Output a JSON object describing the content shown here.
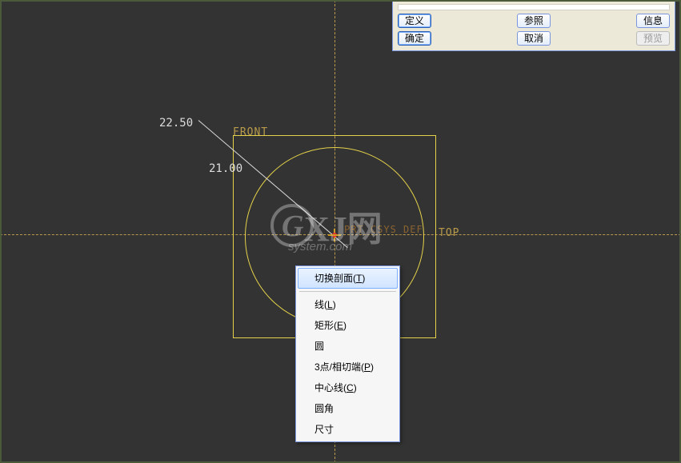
{
  "dialog": {
    "row1": {
      "define": "定义",
      "reference": "参照",
      "info": "信息"
    },
    "row2": {
      "ok": "确定",
      "cancel": "取消",
      "preview": "预览"
    }
  },
  "dimensions": {
    "d1": "22.50",
    "d2": "21.00"
  },
  "labels": {
    "front": "FRONT",
    "top": "TOP",
    "csys": "PRT_CSYS_DEF"
  },
  "watermark": {
    "main": "XJ网",
    "sub": "system.com"
  },
  "context_menu": {
    "items": [
      {
        "label": "切换剖面",
        "accel": "T",
        "hover": true
      },
      {
        "sep": true
      },
      {
        "label": "线",
        "accel": "L"
      },
      {
        "label": "矩形",
        "accel": "E"
      },
      {
        "label": "圆",
        "accel": ""
      },
      {
        "label": "3点/相切端",
        "accel": "P"
      },
      {
        "label": "中心线",
        "accel": "C"
      },
      {
        "label": "圆角",
        "accel": ""
      },
      {
        "label": "尺寸",
        "accel": ""
      }
    ]
  }
}
